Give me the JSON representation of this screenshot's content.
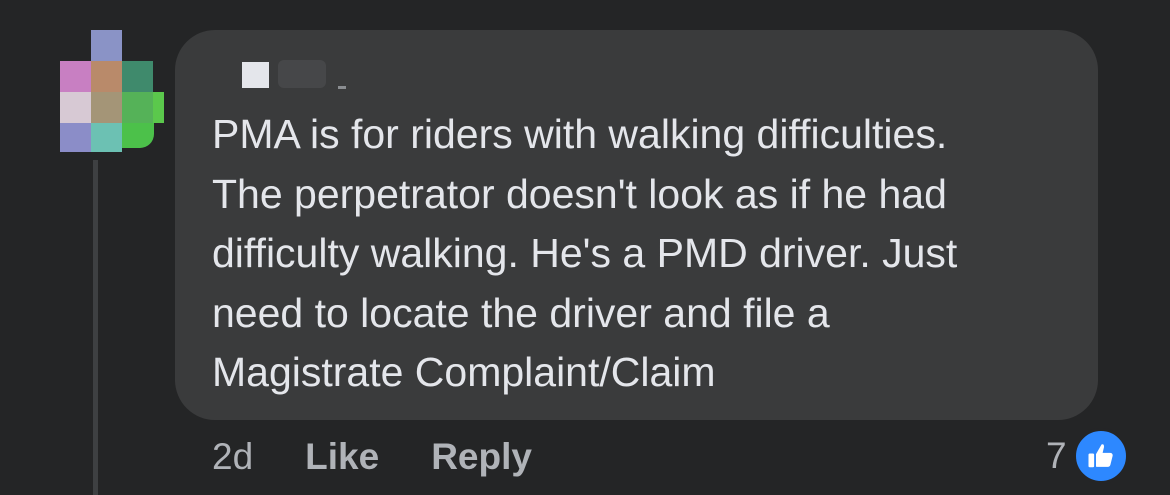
{
  "comment": {
    "author_name": "",
    "text": "PMA is for riders with walking difficulties.\nThe perpetrator doesn't look as if he had\ndifficulty walking. He's a PMD driver. Just\nneed to locate the driver and file a\nMagistrate Complaint/Claim",
    "age": "2d",
    "like_label": "Like",
    "reply_label": "Reply",
    "reaction_count": "7",
    "reaction_icon": "thumbs-up-icon"
  },
  "colors": {
    "background": "#242526",
    "bubble": "#3a3b3c",
    "text_primary": "#e4e6eb",
    "text_secondary": "#b0b3b8",
    "like_blue": "#2d88ff"
  }
}
